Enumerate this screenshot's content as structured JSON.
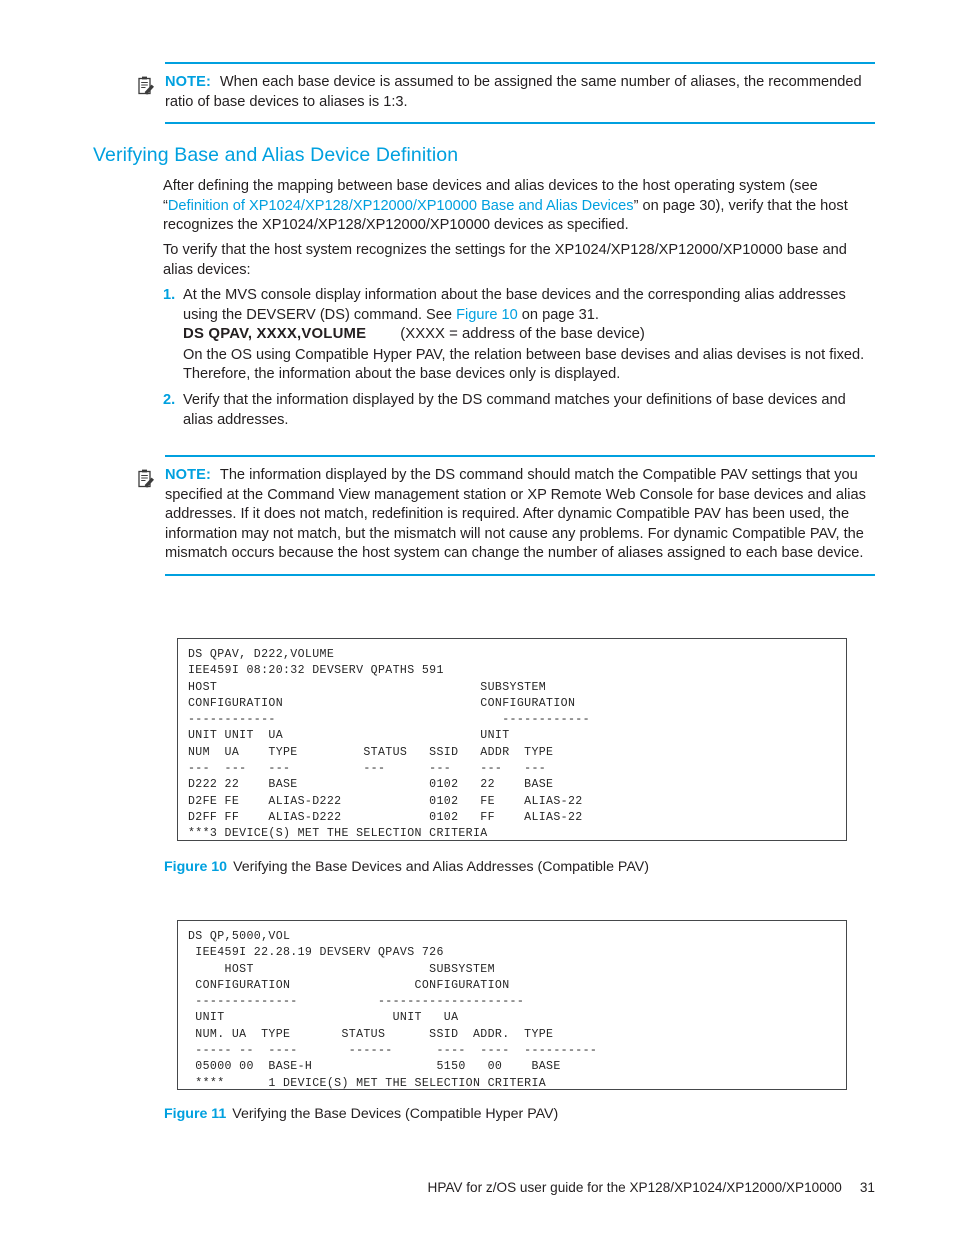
{
  "colors": {
    "accent": "#00a0df",
    "text": "#231f20",
    "box_border": "#45474a",
    "code_text": "#262626"
  },
  "note_top": {
    "icon": "note-clipboard-icon",
    "label": "NOTE:",
    "text": "When each base device is assumed to be assigned the same number of aliases, the recommended ratio of base devices to aliases is 1:3."
  },
  "section": {
    "heading": "Verifying Base and Alias Device Definition"
  },
  "paragraphs": {
    "p1_a": "After defining the mapping between base devices and alias devices to the host operating system (see “",
    "p1_link": "Definition of XP1024/XP128/XP12000/XP10000 Base and Alias Devices",
    "p1_b": "” on page 30), verify that the host recognizes the XP1024/XP128/XP12000/XP10000 devices as specified.",
    "p2": "To verify that the host system recognizes the settings for the XP1024/XP128/XP12000/XP10000 base and alias devices:"
  },
  "steps": [
    {
      "num": "1.",
      "text_a": "At the MVS console display information about the base devices and the corresponding alias addresses using the DEVSERV (DS) command. See ",
      "link": "Figure 10",
      "text_b": " on page 31.",
      "command": "DS QPAV, XXXX,VOLUME",
      "command_note": "(XXXX = address of the base device)",
      "sub_text": "On the OS using Compatible Hyper PAV, the relation between base devises and alias devises is not fixed. Therefore, the information about the base devices only is displayed."
    },
    {
      "num": "2.",
      "text_a": "Verify that the information displayed by the DS command matches your definitions of base devices and alias addresses."
    }
  ],
  "note_bottom": {
    "icon": "note-clipboard-icon",
    "label": "NOTE:",
    "text": "The information displayed by the DS command should match the Compatible PAV settings that you specified at the Command View management station or XP Remote Web Console for base devices and alias addresses. If it does not match, redefinition is required. After dynamic Compatible PAV has been used, the information may not match, but the mismatch will not cause any problems. For dynamic Compatible PAV, the mismatch occurs because the host system can change the number of aliases assigned to each base device."
  },
  "figure10": {
    "console_text": "DS QPAV, D222,VOLUME\nIEE459I 08:20:32 DEVSERV QPATHS 591\nHOST                                    SUBSYSTEM\nCONFIGURATION                           CONFIGURATION\n------------                               ------------\nUNIT UNIT  UA                           UNIT\nNUM  UA    TYPE         STATUS   SSID   ADDR  TYPE\n---  ---   ---          ---      ---    ---   ---\nD222 22    BASE                  0102   22    BASE\nD2FE FE    ALIAS-D222            0102   FE    ALIAS-22\nD2FF FF    ALIAS-D222            0102   FF    ALIAS-22\n***3 DEVICE(S) MET THE SELECTION CRITERIA",
    "caption_num": "Figure 10",
    "caption_text": "Verifying the Base Devices and Alias Addresses (Compatible PAV)"
  },
  "figure11": {
    "console_text": "DS QP,5000,VOL\n IEE459I 22.28.19 DEVSERV QPAVS 726\n     HOST                        SUBSYSTEM\n CONFIGURATION                 CONFIGURATION\n --------------           --------------------\n UNIT                       UNIT   UA\n NUM. UA  TYPE       STATUS      SSID  ADDR.  TYPE\n ----- --  ----       ------      ----  ----  ----------\n 05000 00  BASE-H                 5150   00    BASE\n ****      1 DEVICE(S) MET THE SELECTION CRITERIA",
    "caption_num": "Figure 11",
    "caption_text": "Verifying the Base Devices (Compatible Hyper PAV)"
  },
  "footer": {
    "title": "HPAV for z/OS user guide for the XP128/XP1024/XP12000/XP10000",
    "page_number": "31"
  }
}
